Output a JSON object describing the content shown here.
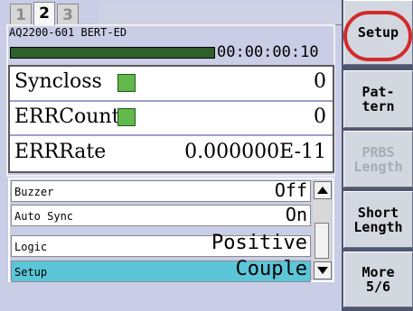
{
  "tabs": [
    "1",
    "2",
    "3"
  ],
  "active_tab": "2",
  "status": {
    "instrument_title": "AQ2200-601 BERT-ED",
    "elapsed_time": "00:00:00:10",
    "progress_fraction": 0.99
  },
  "measurements": {
    "syncloss": {
      "label": "Syncloss",
      "value": "0",
      "lamp_color": "#62b84a"
    },
    "errcount": {
      "label": "ERRCount",
      "value": "0",
      "lamp_color": "#62b84a"
    },
    "errrate": {
      "label": "ERRRate",
      "value": "0.000000E-11"
    }
  },
  "settings": [
    {
      "name": "Buzzer",
      "value": "Off",
      "selected": false
    },
    {
      "name": "Auto Sync",
      "value": "On",
      "selected": false
    },
    {
      "name": "Logic",
      "value": "Positive",
      "selected": false
    },
    {
      "name": "Setup",
      "value": "Couple",
      "selected": true
    }
  ],
  "softkeys": [
    {
      "label": "Setup",
      "enabled": true,
      "highlighted": true
    },
    {
      "label": "Pat-\ntern",
      "enabled": true
    },
    {
      "label": "PRBS\nLength",
      "enabled": false
    },
    {
      "label": "Short\nLength",
      "enabled": true
    },
    {
      "label": "More\n5/6",
      "enabled": true
    }
  ],
  "colors": {
    "accent_selected_row": "#5bc6d8",
    "lamp_green": "#62b84a",
    "highlight_ring": "#d22a2a"
  }
}
